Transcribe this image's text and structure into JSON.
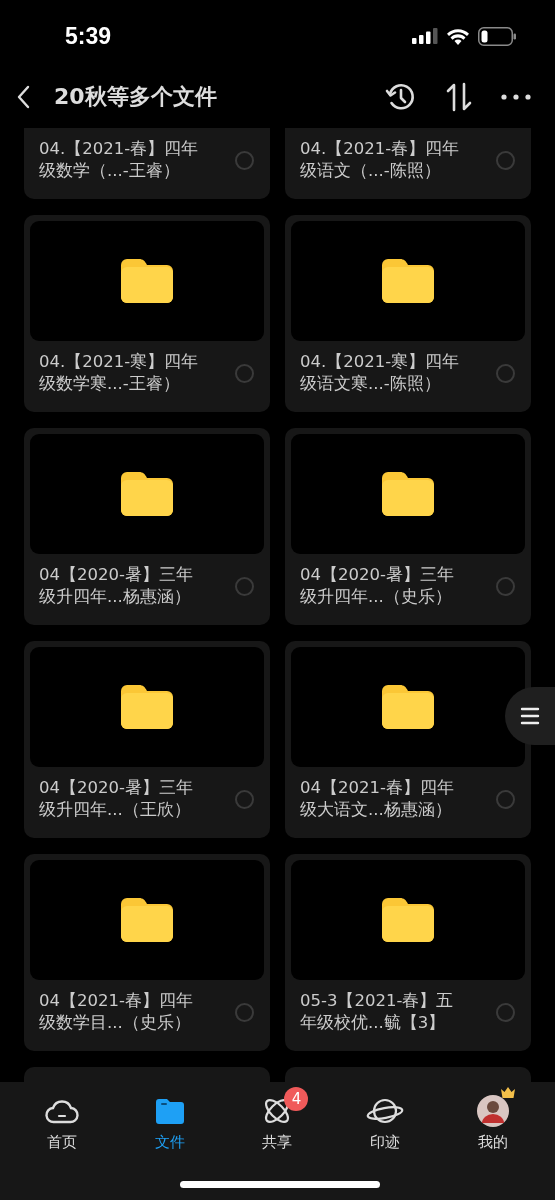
{
  "status_bar": {
    "time": "5:39"
  },
  "header": {
    "title": "20秋等多个文件"
  },
  "files": [
    {
      "kind": "cut",
      "name": "04.【2021-春】四年级数学（...-王睿）",
      "selected": false
    },
    {
      "kind": "cut",
      "name": "04.【2021-春】四年级语文（...-陈照）",
      "selected": false
    },
    {
      "kind": "folder",
      "name": "04.【2021-寒】四年级数学寒...-王睿）",
      "selected": false
    },
    {
      "kind": "folder",
      "name": "04.【2021-寒】四年级语文寒...-陈照）",
      "selected": false
    },
    {
      "kind": "folder",
      "name": "04【2020-暑】三年级升四年...杨惠涵）",
      "selected": false
    },
    {
      "kind": "folder",
      "name": "04【2020-暑】三年级升四年...（史乐）",
      "selected": false
    },
    {
      "kind": "folder",
      "name": "04【2020-暑】三年级升四年...（王欣）",
      "selected": false
    },
    {
      "kind": "folder",
      "name": "04【2021-春】四年级大语文...杨惠涵）",
      "selected": false
    },
    {
      "kind": "folder",
      "name": "04【2021-春】四年级数学目...（史乐）",
      "selected": false
    },
    {
      "kind": "folder",
      "name": "05-3【2021-春】五年级校优...毓【3】",
      "selected": false
    }
  ],
  "tab_bar": [
    {
      "label": "首页",
      "selected": false
    },
    {
      "label": "文件",
      "selected": true
    },
    {
      "label": "共享",
      "selected": false,
      "badge": "4"
    },
    {
      "label": "印迹",
      "selected": false
    },
    {
      "label": "我的",
      "selected": false
    }
  ]
}
